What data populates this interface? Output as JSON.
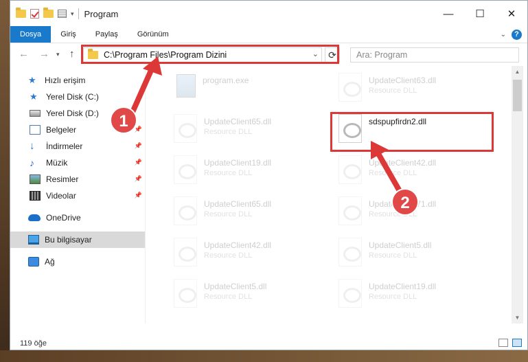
{
  "window": {
    "title": "Program",
    "buttons": {
      "minimize": "—",
      "maximize": "☐",
      "close": "✕"
    }
  },
  "ribbon": {
    "tabs": [
      "Dosya",
      "Giriş",
      "Paylaş",
      "Görünüm"
    ],
    "help": "?"
  },
  "address": {
    "path": "C:\\Program Files\\Program Dizini",
    "search_placeholder": "Ara: Program"
  },
  "nav": {
    "items": [
      {
        "label": "Hızlı erişim"
      },
      {
        "label": "Yerel Disk (C:)"
      },
      {
        "label": "Yerel Disk (D:)"
      },
      {
        "label": "Belgeler"
      },
      {
        "label": "İndirmeler"
      },
      {
        "label": "Müzik"
      },
      {
        "label": "Resimler"
      },
      {
        "label": "Videolar"
      },
      {
        "label": "OneDrive"
      },
      {
        "label": "Bu bilgisayar"
      },
      {
        "label": "Ağ"
      }
    ]
  },
  "files": [
    {
      "name": "program.exe",
      "type": ""
    },
    {
      "name": "UpdateClient63.dll",
      "type": "Resource DLL"
    },
    {
      "name": "UpdateClient65.dll",
      "type": "Resource DLL"
    },
    {
      "name": "sdspupfirdn2.dll",
      "type": ""
    },
    {
      "name": "UpdateClient19.dll",
      "type": "Resource DLL"
    },
    {
      "name": "UpdateClient42.dll",
      "type": "Resource DLL"
    },
    {
      "name": "UpdateClient65.dll",
      "type": "Resource DLL"
    },
    {
      "name": "UpdateClient71.dll",
      "type": "Resource DLL"
    },
    {
      "name": "UpdateClient42.dll",
      "type": "Resource DLL"
    },
    {
      "name": "UpdateClient5.dll",
      "type": "Resource DLL"
    },
    {
      "name": "UpdateClient5.dll",
      "type": "Resource DLL"
    },
    {
      "name": "UpdateClient19.dll",
      "type": "Resource DLL"
    }
  ],
  "status": {
    "count": "119 öğe"
  },
  "annotations": {
    "step1": "1",
    "step2": "2"
  },
  "colors": {
    "accent": "#1979ca",
    "highlight": "#dd3838"
  }
}
